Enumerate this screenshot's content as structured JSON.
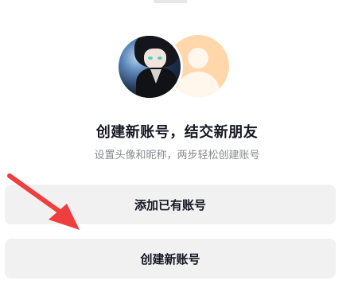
{
  "title": "创建新账号，结交新朋友",
  "subtitle": "设置头像和昵称，两步轻松创建账号",
  "buttons": {
    "add_existing": "添加已有账号",
    "create_new": "创建新账号"
  },
  "icons": [
    "user-avatar",
    "default-avatar-icon",
    "red-arrow-annotation"
  ],
  "colors": {
    "arrow": "#ef3e3e",
    "default_avatar": "#ffd7aa",
    "button_bg": "#f1f1f2"
  }
}
